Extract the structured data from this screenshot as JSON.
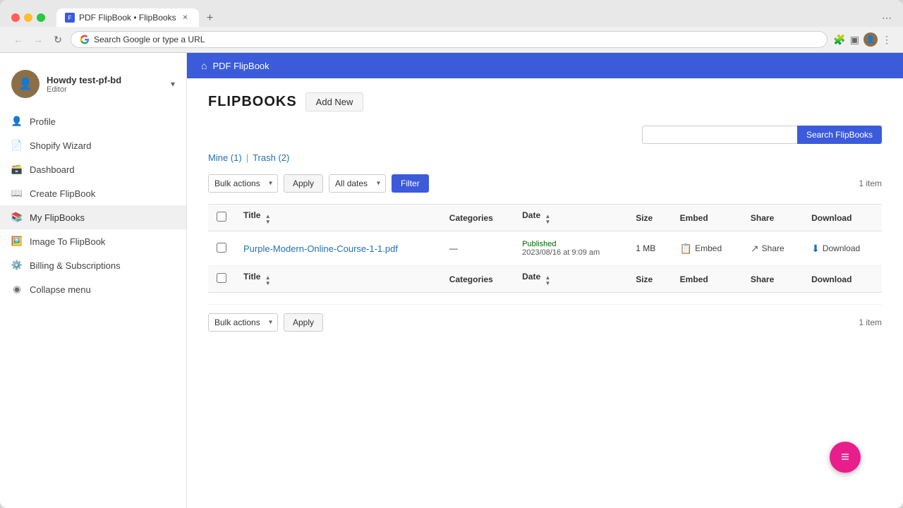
{
  "browser": {
    "tab_title": "PDF FlipBook • FlipBooks",
    "url": "Search Google or type a URL",
    "new_tab_label": "+",
    "back_btn": "←",
    "forward_btn": "→",
    "refresh_btn": "↻"
  },
  "header": {
    "home_icon": "⌂",
    "site_title": "PDF FlipBook"
  },
  "sidebar": {
    "user_name": "Howdy test-pf-bd",
    "user_role": "Editor",
    "dropdown_icon": "▾",
    "nav_items": [
      {
        "label": "Profile",
        "icon": "👤"
      },
      {
        "label": "Shopify Wizard",
        "icon": "📄"
      },
      {
        "label": "Dashboard",
        "icon": "🗃️"
      },
      {
        "label": "Create FlipBook",
        "icon": "📖"
      },
      {
        "label": "My FlipBooks",
        "icon": "📚",
        "active": true
      },
      {
        "label": "Image To FlipBook",
        "icon": "🖼️"
      },
      {
        "label": "Billing & Subscriptions",
        "icon": "⚙️"
      },
      {
        "label": "Collapse menu",
        "icon": "◉"
      }
    ]
  },
  "main": {
    "page_title": "FLIPBOOKS",
    "add_new_label": "Add New",
    "search_placeholder": "",
    "search_btn_label": "Search FlipBooks",
    "filter_tabs": [
      {
        "label": "Mine (1)",
        "href": "#"
      },
      {
        "label": "Trash (2)",
        "href": "#"
      }
    ],
    "toolbar": {
      "bulk_actions_label": "Bulk actions",
      "apply_label": "Apply",
      "all_dates_label": "All dates",
      "filter_label": "Filter",
      "item_count": "1 item"
    },
    "table_headers": {
      "title": "Title",
      "categories": "Categories",
      "date": "Date",
      "size": "Size",
      "embed": "Embed",
      "share": "Share",
      "download": "Download"
    },
    "table_rows": [
      {
        "title": "Purple-Modern-Online-Course-1-1.pdf",
        "categories": "—",
        "status": "Published",
        "date": "2023/08/16 at 9:09 am",
        "size": "1 MB",
        "embed_label": "Embed",
        "share_label": "Share",
        "download_label": "Download"
      }
    ],
    "bottom_toolbar": {
      "bulk_actions_label": "Bulk actions",
      "apply_label": "Apply",
      "item_count": "1 item"
    },
    "fab_icon": "≡"
  }
}
